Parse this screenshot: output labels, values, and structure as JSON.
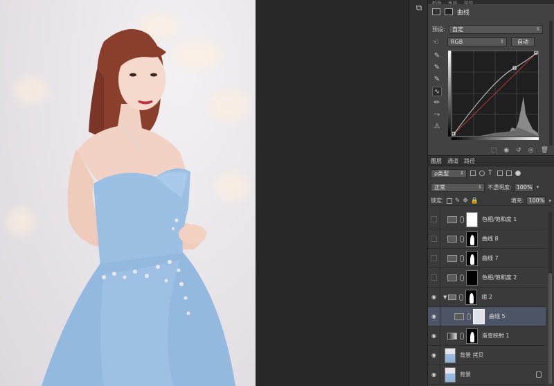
{
  "properties": {
    "tabs": [
      "颜色",
      "色板",
      "属性"
    ],
    "adjustment_title": "曲线",
    "preset_label": "预设:",
    "preset_value": "自定",
    "channel_value": "RGB",
    "auto_button": "自动"
  },
  "layers_panel": {
    "tabs": [
      "图层",
      "通道",
      "路径"
    ],
    "filter_label": "ρ类型",
    "blend_mode": "正常",
    "opacity_label": "不透明度:",
    "opacity_value": "100%",
    "lock_label": "锁定:",
    "fill_label": "填充:",
    "fill_value": "100%",
    "layers": [
      {
        "name": "色相/饱和度 1",
        "visible": false
      },
      {
        "name": "曲线 8",
        "visible": false
      },
      {
        "name": "曲线 7",
        "visible": false
      },
      {
        "name": "色相/饱和度 2",
        "visible": false
      },
      {
        "name": "组 2",
        "visible": true
      },
      {
        "name": "曲线 5",
        "visible": true,
        "selected": true
      },
      {
        "name": "渐变映射 1",
        "visible": true
      },
      {
        "name": "背景 拷贝",
        "visible": true
      },
      {
        "name": "背景",
        "visible": true,
        "locked": true
      }
    ]
  },
  "colors": {
    "panel_bg": "#3a3a3a",
    "selected_row": "#4d5466",
    "dress_blue": "#9cc0e4"
  }
}
